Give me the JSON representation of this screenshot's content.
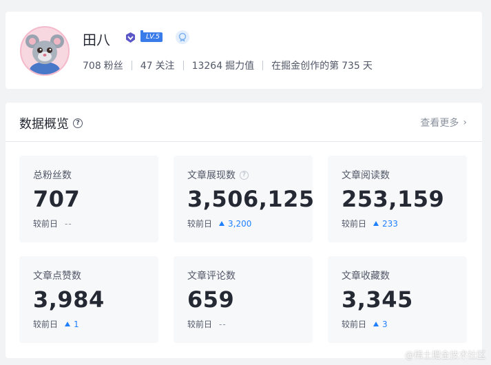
{
  "profile": {
    "username": "田八",
    "level_badge": "LV.5",
    "stats": [
      {
        "value": "708",
        "label": "粉丝"
      },
      {
        "value": "47",
        "label": "关注"
      },
      {
        "value": "13264",
        "label": "掘力值"
      }
    ],
    "days_prefix": "在掘金创作的第",
    "days_value": "735",
    "days_suffix": "天"
  },
  "overview": {
    "title": "数据概览",
    "see_more": "查看更多",
    "metrics": [
      {
        "label": "总粉丝数",
        "value": "707",
        "delta_label": "较前日",
        "delta": "--"
      },
      {
        "label": "文章展现数",
        "value": "3,506,125",
        "delta_label": "较前日",
        "delta": "3,200"
      },
      {
        "label": "文章阅读数",
        "value": "253,159",
        "delta_label": "较前日",
        "delta": "233"
      },
      {
        "label": "文章点赞数",
        "value": "3,984",
        "delta_label": "较前日",
        "delta": "1"
      },
      {
        "label": "文章评论数",
        "value": "659",
        "delta_label": "较前日",
        "delta": "--"
      },
      {
        "label": "文章收藏数",
        "value": "3,345",
        "delta_label": "较前日",
        "delta": "3"
      }
    ]
  },
  "watermark": "@稀土掘金技术社区",
  "colors": {
    "accent": "#1e80ff",
    "level_badge": "#3a7bea"
  }
}
